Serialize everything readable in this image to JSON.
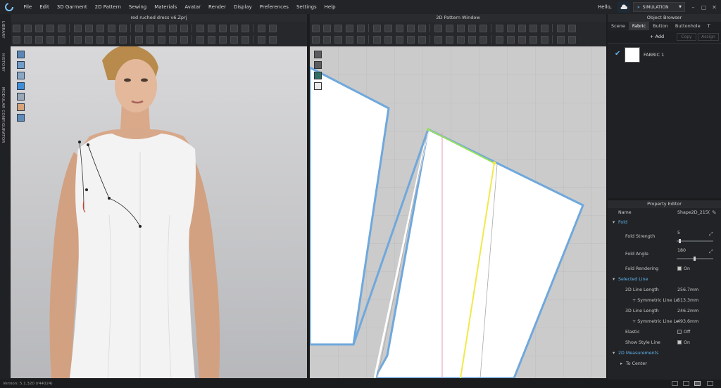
{
  "menu": {
    "items": [
      "File",
      "Edit",
      "3D Garment",
      "2D Pattern",
      "Sewing",
      "Materials",
      "Avatar",
      "Render",
      "Display",
      "Preferences",
      "Settings",
      "Help"
    ],
    "hello": "Hello,",
    "mode": "SIMULATION"
  },
  "side_tabs": [
    "LIBRARY",
    "HISTORY",
    "MODULAR CONFIGURATOR"
  ],
  "view3d": {
    "title": "red ruched dress v6.Zprj"
  },
  "view2d": {
    "title": "2D Pattern Window"
  },
  "object_browser": {
    "title": "Object Browser",
    "tabs": [
      "Scene",
      "Fabric",
      "Button",
      "Buttonhole",
      "T"
    ],
    "active_tab": "Fabric",
    "add_label": "+ Add",
    "copy_label": "Copy",
    "assign_label": "Assign",
    "fabric_name": "FABRIC 1"
  },
  "property_editor": {
    "title": "Property Editor",
    "name_label": "Name",
    "name_value": "Shape2D_215(",
    "fold_section": "Fold",
    "fold_strength_label": "Fold Strength",
    "fold_strength_value": "5",
    "fold_angle_label": "Fold Angle",
    "fold_angle_value": "180",
    "fold_rendering_label": "Fold Rendering",
    "fold_rendering_value": "On",
    "selected_line_section": "Selected Line",
    "line2d_label": "2D Line Length",
    "line2d_value": "256.7mm",
    "sym2d_label": "+ Symmetric Line Le",
    "sym2d_value": "513.3mm",
    "line3d_label": "3D Line Length",
    "line3d_value": "246.2mm",
    "sym3d_label": "+ Symmetric Line Le",
    "sym3d_value": "493.6mm",
    "elastic_label": "Elastic",
    "elastic_value": "Off",
    "show_style_label": "Show Style Line",
    "show_style_value": "On",
    "measurements_section": "2D Measurements",
    "to_center_label": "To Center"
  },
  "status": {
    "version": "Version: 5.1.320 (r44024)"
  }
}
